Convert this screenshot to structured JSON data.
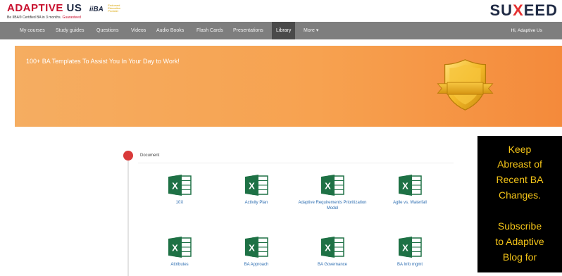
{
  "brand": {
    "logo_main": "ADAPTIVE",
    "logo_us": "US",
    "iiba_text": "iiBA",
    "iiba_note": "Endorsed Education Provider",
    "tagline_prefix": "Be IIBA® Certified BA in 3 months.",
    "tagline_guarantee": "Guaranteed",
    "suxeed_left": "SU",
    "suxeed_x": "X",
    "suxeed_right": "EED"
  },
  "nav": {
    "items": [
      "My courses",
      "Study guides",
      "Questions",
      "Videos",
      "Audio Books",
      "Flash Cards",
      "Presentations",
      "Library",
      "More ▾"
    ],
    "active_index": 7,
    "user_greeting": "Hi, Adaptive Us"
  },
  "banner": {
    "text": "100+ BA Templates To Assist You In Your Day to Work!",
    "gradient_start": "#f5ad61",
    "gradient_end": "#f48a3b"
  },
  "section": {
    "label": "Document",
    "accent_color": "#d93a3a"
  },
  "templates": [
    {
      "label": "10X",
      "icon": "excel-icon"
    },
    {
      "label": "Activity Plan",
      "icon": "excel-icon"
    },
    {
      "label": "Adaptive Requirements Prioritization Model",
      "icon": "excel-icon"
    },
    {
      "label": "Agile vs. Waterfall",
      "icon": "excel-icon"
    },
    {
      "label": "Attributes",
      "icon": "excel-icon"
    },
    {
      "label": "BA Approach",
      "icon": "excel-icon"
    },
    {
      "label": "BA Governance",
      "icon": "excel-icon"
    },
    {
      "label": "BA Info mgmt",
      "icon": "excel-icon"
    }
  ],
  "promo": {
    "lines": [
      "Keep",
      "Abreast of",
      "Recent BA",
      "Changes.",
      "",
      "Subscribe",
      "to Adaptive",
      "Blog for"
    ],
    "text_color": "#f5c518",
    "background": "#000000"
  }
}
